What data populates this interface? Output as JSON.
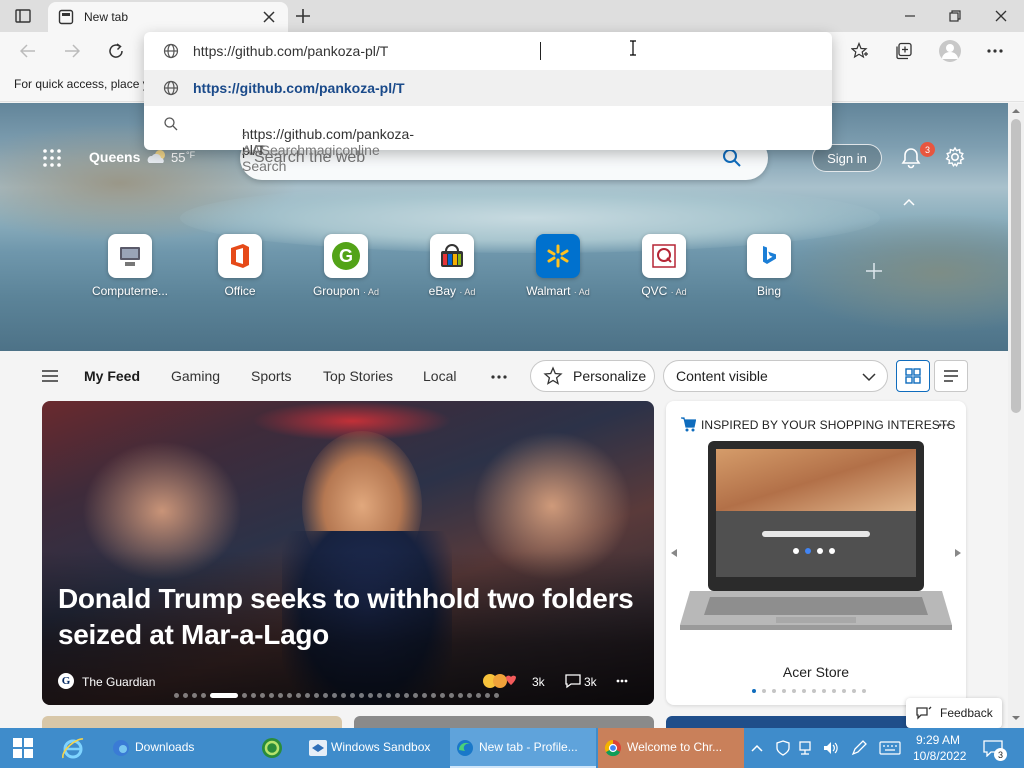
{
  "browser": {
    "tab_title": "New tab",
    "omnibox_value": "https://github.com/pankoza-pl/T",
    "suggestions": [
      {
        "text": "https://github.com/pankoza-pl/T",
        "suffix": ""
      },
      {
        "text": "https://github.com/pankoza-pl/T",
        "suffix": " - AASearchmagiconline Search"
      }
    ],
    "favorites_hint": "For quick access, place y"
  },
  "newtab": {
    "location": "Queens",
    "temperature": "55",
    "temp_unit": "°F",
    "search_placeholder": "Search the web",
    "sign_in": "Sign in",
    "notification_count": "3",
    "quick_links": [
      {
        "name": "Computerne...",
        "ad": ""
      },
      {
        "name": "Office",
        "ad": ""
      },
      {
        "name": "Groupon",
        "ad": "· Ad"
      },
      {
        "name": "eBay",
        "ad": "· Ad"
      },
      {
        "name": "Walmart",
        "ad": "· Ad"
      },
      {
        "name": "QVC",
        "ad": "· Ad"
      },
      {
        "name": "Bing",
        "ad": ""
      }
    ],
    "feed_tabs": [
      "My Feed",
      "Gaming",
      "Sports",
      "Top Stories",
      "Local"
    ],
    "personalize": "Personalize",
    "content_visibility": "Content visible",
    "headline": "Donald Trump seeks to withhold two folders seized at Mar-a-Lago",
    "source": "The Guardian",
    "reactions": "3k",
    "comments": "3k",
    "shopping_header": "INSPIRED BY YOUR SHOPPING INTERESTS",
    "store": "Acer Store",
    "feedback": "Feedback"
  },
  "colors": {
    "accent": "#0f6cbd",
    "taskbar": "#3f8ccb",
    "chrome_task": "#c9805a"
  },
  "taskbar": {
    "items": [
      "Downloads",
      "Windows Sandbox",
      "New tab - Profile...",
      "Welcome to Chr..."
    ],
    "time": "9:29 AM",
    "date": "10/8/2022",
    "notifications": "3"
  }
}
